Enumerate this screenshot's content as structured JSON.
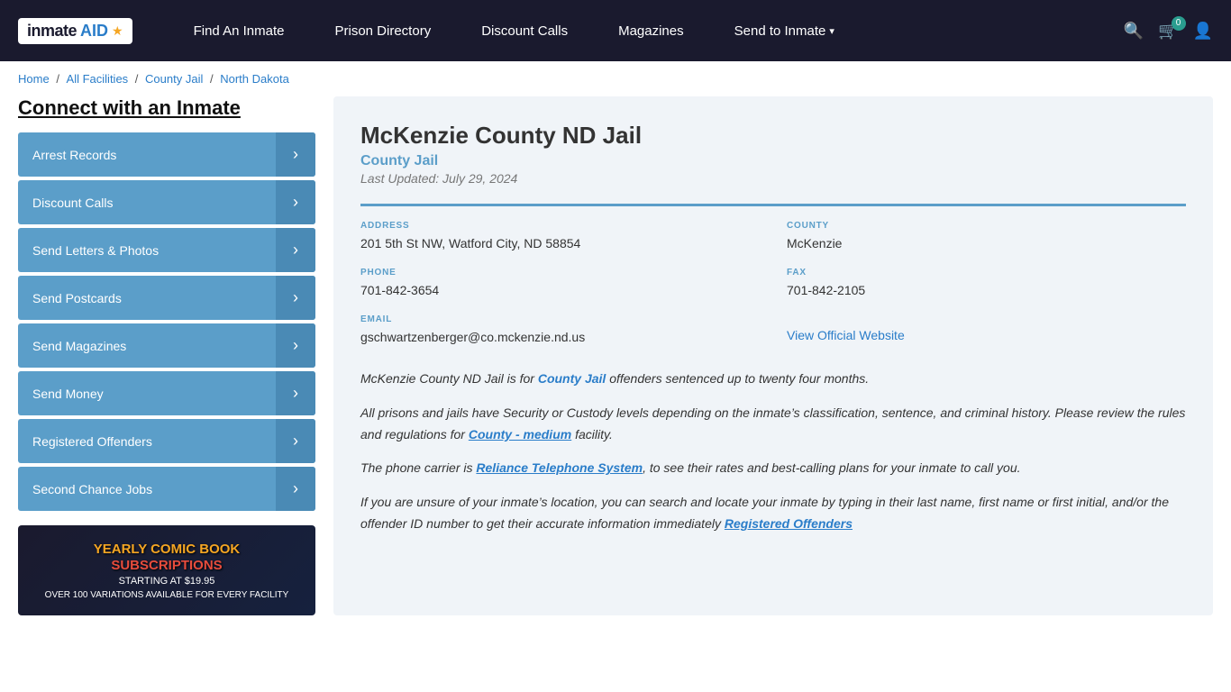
{
  "nav": {
    "logo": "inmateAID",
    "links": [
      {
        "label": "Find An Inmate",
        "hasDropdown": false
      },
      {
        "label": "Prison Directory",
        "hasDropdown": false
      },
      {
        "label": "Discount Calls",
        "hasDropdown": false
      },
      {
        "label": "Magazines",
        "hasDropdown": false
      },
      {
        "label": "Send to Inmate",
        "hasDropdown": true
      }
    ],
    "cart_count": "0"
  },
  "breadcrumb": {
    "items": [
      "Home",
      "All Facilities",
      "County Jail",
      "North Dakota"
    ]
  },
  "sidebar": {
    "title": "Connect with an Inmate",
    "buttons": [
      {
        "label": "Arrest Records"
      },
      {
        "label": "Discount Calls"
      },
      {
        "label": "Send Letters & Photos"
      },
      {
        "label": "Send Postcards"
      },
      {
        "label": "Send Magazines"
      },
      {
        "label": "Send Money"
      },
      {
        "label": "Registered Offenders"
      },
      {
        "label": "Second Chance Jobs"
      }
    ],
    "ad": {
      "line1": "YEARLY COMIC BOOK",
      "line2": "SUBSCRIPTIONS",
      "price": "STARTING AT $19.95",
      "sub": "OVER 100 VARIATIONS AVAILABLE FOR EVERY FACILITY"
    }
  },
  "facility": {
    "title": "McKenzie County ND Jail",
    "type": "County Jail",
    "updated": "Last Updated: July 29, 2024",
    "address_label": "ADDRESS",
    "address_value": "201 5th St NW, Watford City, ND 58854",
    "county_label": "COUNTY",
    "county_value": "McKenzie",
    "phone_label": "PHONE",
    "phone_value": "701-842-3654",
    "fax_label": "FAX",
    "fax_value": "701-842-2105",
    "email_label": "EMAIL",
    "email_value": "gschwartzenberger@co.mckenzie.nd.us",
    "website_label": "View Official Website",
    "website_url": "#"
  },
  "description": {
    "para1_before": "McKenzie County ND Jail is for ",
    "para1_link": "County Jail",
    "para1_after": " offenders sentenced up to twenty four months.",
    "para2": "All prisons and jails have Security or Custody levels depending on the inmate’s classification, sentence, and criminal history. Please review the rules and regulations for ",
    "para2_link": "County - medium",
    "para2_after": " facility.",
    "para3_before": "The phone carrier is ",
    "para3_link": "Reliance Telephone System",
    "para3_after": ", to see their rates and best-calling plans for your inmate to call you.",
    "para4": "If you are unsure of your inmate’s location, you can search and locate your inmate by typing in their last name, first name or first initial, and/or the offender ID number to get their accurate information immediately",
    "para4_link": "Registered Offenders"
  }
}
